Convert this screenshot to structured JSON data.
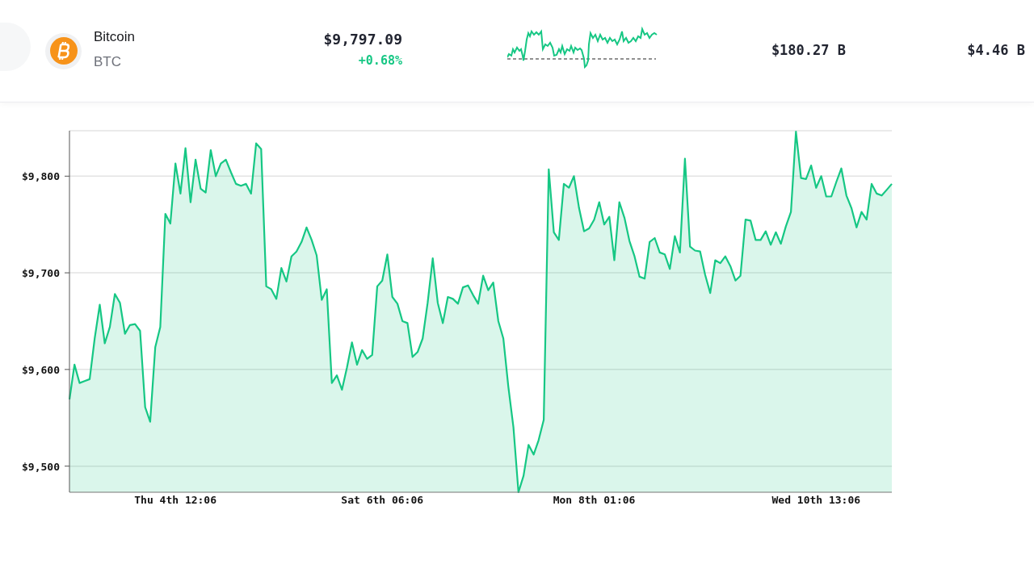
{
  "coin": {
    "name": "Bitcoin",
    "symbol": "BTC",
    "price": "$9,797.09",
    "change": "+0.68%",
    "market_cap": "$180.27 B",
    "volume": "$4.46 B"
  },
  "chart": {
    "chart_data": {
      "type": "area",
      "grid": true,
      "ylim": [
        9473,
        9847
      ],
      "categories": [
        null,
        null,
        null,
        null,
        null,
        null,
        null,
        null,
        null,
        null,
        null,
        null,
        null,
        null,
        null,
        null,
        null,
        null,
        null,
        null,
        null,
        "Thu 4th 12:06",
        null,
        null,
        null,
        null,
        null,
        null,
        null,
        null,
        null,
        null,
        null,
        null,
        null,
        null,
        null,
        null,
        null,
        null,
        null,
        null,
        null,
        null,
        null,
        null,
        null,
        null,
        null,
        null,
        null,
        null,
        null,
        null,
        null,
        null,
        null,
        null,
        null,
        null,
        null,
        null,
        "Sat 6th 06:06",
        null,
        null,
        null,
        null,
        null,
        null,
        null,
        null,
        null,
        null,
        null,
        null,
        null,
        null,
        null,
        null,
        null,
        null,
        null,
        null,
        null,
        null,
        null,
        null,
        null,
        null,
        null,
        null,
        null,
        null,
        null,
        null,
        null,
        null,
        null,
        null,
        null,
        null,
        null,
        null,
        null,
        "Mon 8th 01:06",
        null,
        null,
        null,
        null,
        null,
        null,
        null,
        null,
        null,
        null,
        null,
        null,
        null,
        null,
        null,
        null,
        null,
        null,
        null,
        null,
        null,
        null,
        null,
        null,
        null,
        null,
        null,
        null,
        null,
        null,
        null,
        null,
        null,
        null,
        null,
        null,
        null,
        null,
        null,
        null,
        null,
        null,
        null,
        "Wed 10th 13:06",
        null,
        null,
        null,
        null,
        null,
        null,
        null,
        null,
        null,
        null,
        null,
        null,
        null,
        null,
        null
      ],
      "series": [
        {
          "color": "#16c784",
          "values": [
            9569,
            9605,
            9586,
            9588,
            9590,
            9632,
            9667,
            9627,
            9644,
            9678,
            9669,
            9637,
            9646,
            9647,
            9640,
            9561,
            9546,
            9623,
            9644,
            9761,
            9751,
            9813,
            9782,
            9829,
            9773,
            9817,
            9787,
            9783,
            9827,
            9800,
            9813,
            9817,
            9804,
            9792,
            9790,
            9792,
            9782,
            9834,
            9828,
            9686,
            9683,
            9673,
            9705,
            9691,
            9717,
            9722,
            9732,
            9747,
            9734,
            9718,
            9672,
            9683,
            9586,
            9594,
            9579,
            9602,
            9628,
            9605,
            9620,
            9611,
            9615,
            9686,
            9692,
            9719,
            9675,
            9668,
            9650,
            9648,
            9613,
            9618,
            9632,
            9669,
            9715,
            9669,
            9648,
            9675,
            9673,
            9668,
            9685,
            9687,
            9677,
            9668,
            9697,
            9682,
            9690,
            9650,
            9632,
            9582,
            9540,
            9473,
            9490,
            9522,
            9512,
            9527,
            9548,
            9807,
            9742,
            9734,
            9792,
            9788,
            9800,
            9767,
            9743,
            9746,
            9755,
            9773,
            9750,
            9758,
            9713,
            9773,
            9757,
            9733,
            9717,
            9696,
            9694,
            9732,
            9736,
            9721,
            9719,
            9704,
            9738,
            9721,
            9818,
            9727,
            9723,
            9722,
            9698,
            9679,
            9713,
            9710,
            9717,
            9707,
            9692,
            9697,
            9755,
            9754,
            9734,
            9734,
            9743,
            9729,
            9742,
            9730,
            9748,
            9763,
            9846,
            9798,
            9797,
            9811,
            9788,
            9800,
            9779,
            9779,
            9794,
            9808,
            9780,
            9767,
            9747,
            9763,
            9755,
            9792,
            9782,
            9780,
            9786,
            9792
          ]
        }
      ],
      "yticks": [
        {
          "value": 9500,
          "label": "$9,500"
        },
        {
          "value": 9600,
          "label": "$9,600"
        },
        {
          "value": 9700,
          "label": "$9,700"
        },
        {
          "value": 9800,
          "label": "$9,800"
        }
      ]
    }
  }
}
